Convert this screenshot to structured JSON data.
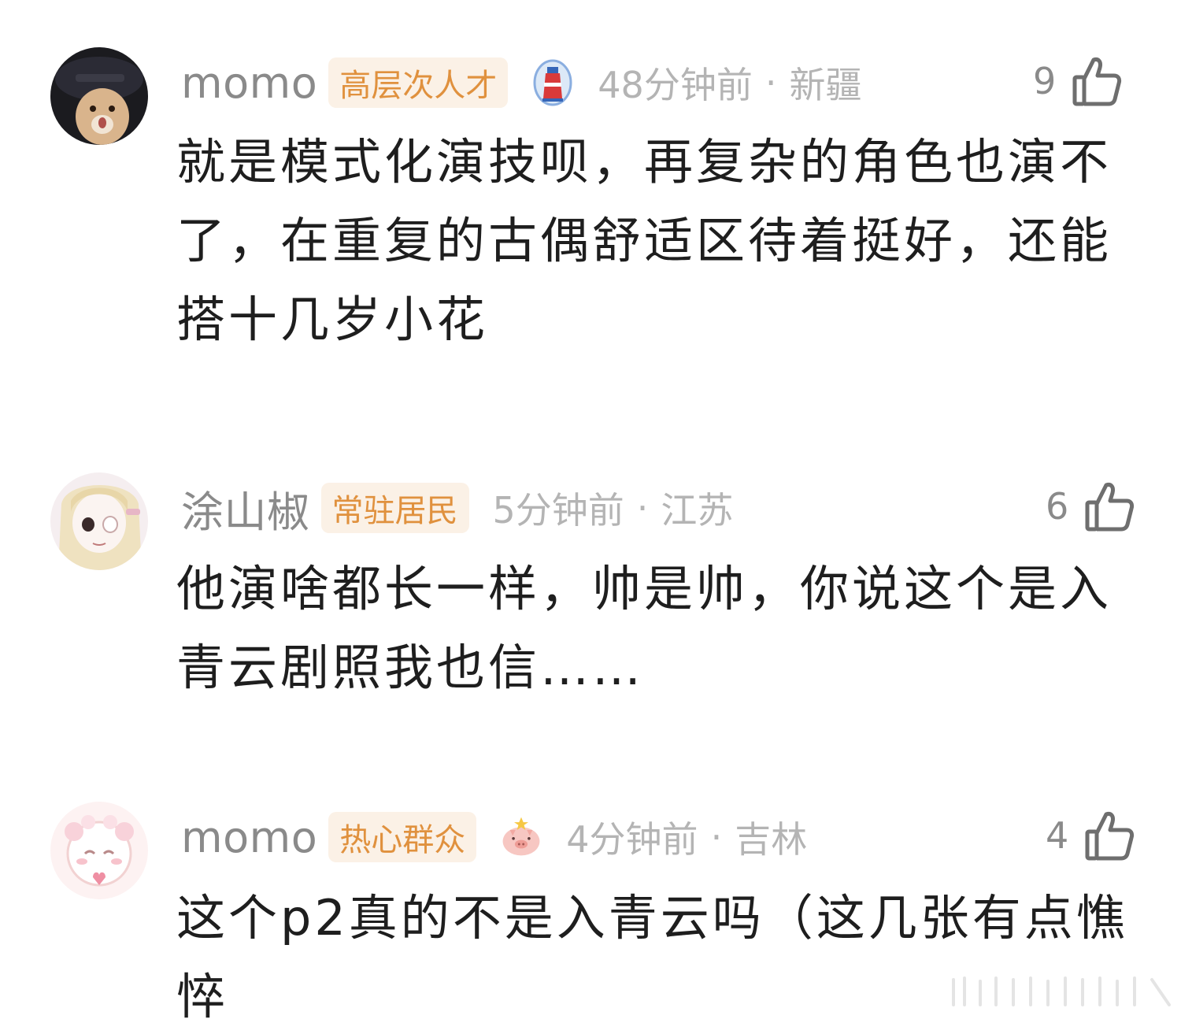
{
  "comments": [
    {
      "username": "momo",
      "badge": "高层次人才",
      "medal_icon": "lighthouse-medal-icon",
      "time": "48分钟前",
      "location": "新疆",
      "separator": "·",
      "likes": "9",
      "text": "就是模式化演技呗，再复杂的角色也演不了，在重复的古偶舒适区待着挺好，还能搭十几岁小花"
    },
    {
      "username": "涂山椒",
      "badge": "常驻居民",
      "time": "5分钟前",
      "location": "江苏",
      "separator": "·",
      "likes": "6",
      "text": "他演啥都长一样，帅是帅，你说这个是入青云剧照我也信……"
    },
    {
      "username": "momo",
      "badge": "热心群众",
      "medal_icon": "pig-medal-icon",
      "time": "4分钟前",
      "location": "吉林",
      "separator": "·",
      "likes": "4",
      "text": "这个p2真的不是入青云吗（这几张有点憔悴"
    }
  ],
  "colors": {
    "badge_bg": "#fbf1e6",
    "badge_text": "#e0913e",
    "meta_text": "#b4b4b4",
    "username_text": "#8a8a8a",
    "body_text": "#1e1e1e"
  }
}
